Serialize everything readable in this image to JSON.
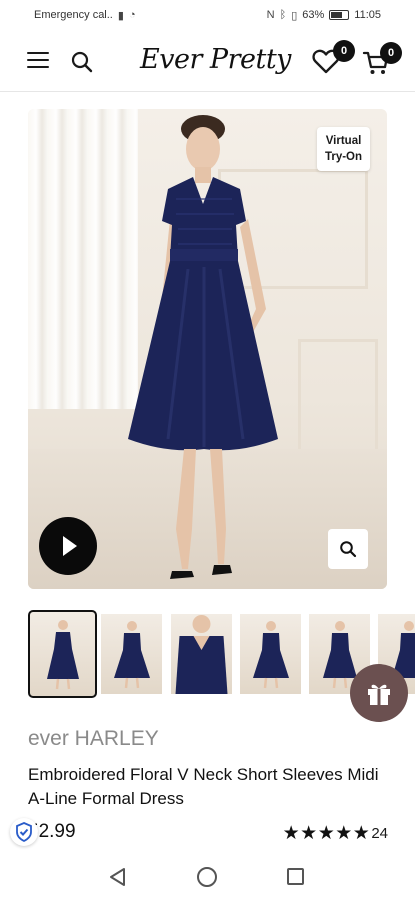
{
  "status_bar": {
    "carrier": "Emergency cal..",
    "battery_percent": "63%",
    "time": "11:05",
    "icons": [
      "signal-icon",
      "wifi-icon",
      "nfc-icon",
      "bluetooth-icon",
      "vibrate-icon",
      "battery-icon"
    ]
  },
  "header": {
    "logo_text": "Ever Pretty",
    "wishlist_count": "0",
    "cart_count": "0",
    "icons": [
      "menu-icon",
      "search-icon",
      "heart-icon",
      "cart-icon"
    ]
  },
  "gallery": {
    "try_on_label_line1": "Virtual",
    "try_on_label_line2": "Try-On",
    "dress_color": "#1c2458",
    "thumbnail_count": 6,
    "active_thumbnail": 1,
    "icons": [
      "play-icon",
      "zoom-icon",
      "gift-icon"
    ]
  },
  "product": {
    "brand": "ever HARLEY",
    "title": "Embroidered Floral V Neck Short Sleeves Midi A-Line Formal Dress",
    "price": "52.99",
    "rating": 5,
    "stars": "★★★★★",
    "review_count": "24"
  },
  "colors": {
    "accent": "#111111",
    "gift_button": "#6b5050",
    "brand_text": "#8a8a8a"
  }
}
